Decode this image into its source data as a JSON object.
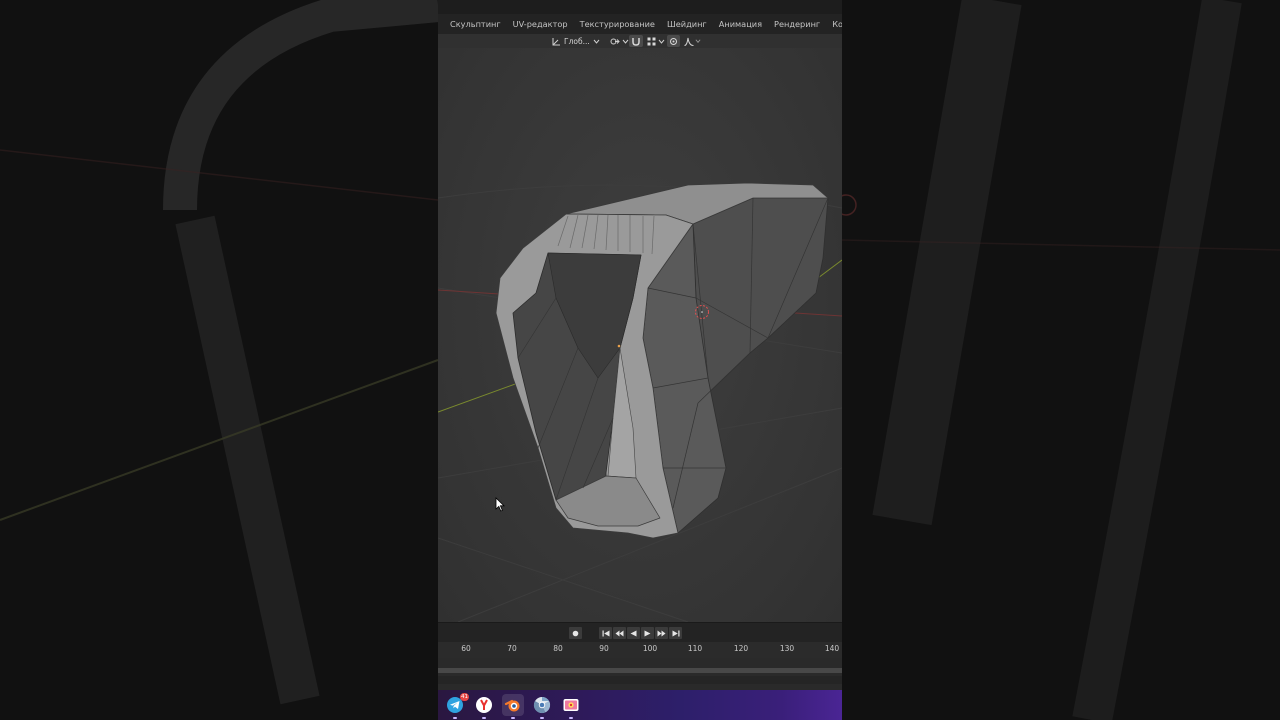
{
  "workspace_tabs": [
    "Скульптинг",
    "UV-редактор",
    "Текстурирование",
    "Шейдинг",
    "Анимация",
    "Рендеринг",
    "Композитинг"
  ],
  "header": {
    "orientation_label": "Глоб..."
  },
  "timeline": {
    "frame_labels": [
      "60",
      "70",
      "80",
      "90",
      "100",
      "110",
      "120",
      "130",
      "140"
    ]
  },
  "taskbar": {
    "telegram_badge": "41"
  },
  "colors": {
    "accent_selected": "#e8a04a",
    "x_axis": "#8a3a3a",
    "y_axis": "#7c8a2a",
    "origin_circle": "#e05050"
  },
  "icons": {
    "telegram": "telegram-icon",
    "yandex": "yandex-browser-icon",
    "blender": "blender-icon",
    "chrome": "chrome-icon",
    "screen_capture": "screen-capture-icon"
  }
}
